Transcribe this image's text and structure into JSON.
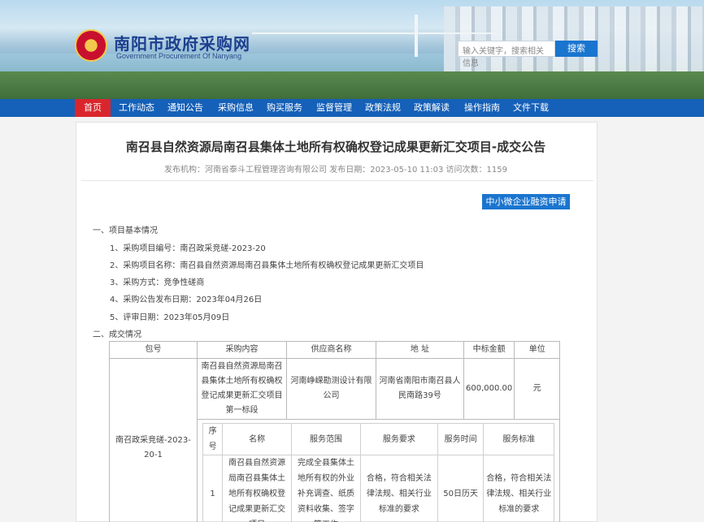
{
  "site": {
    "title": "南阳市政府采购网",
    "subtitle": "Government Procurement Of Nanyang",
    "logo_icon": "national-emblem-icon",
    "search_placeholder": "输入关键字，搜索相关信息",
    "search_button": "搜索"
  },
  "nav": {
    "items": [
      {
        "label": "首页",
        "active": true
      },
      {
        "label": "工作动态"
      },
      {
        "label": "通知公告"
      },
      {
        "label": "采购信息"
      },
      {
        "label": "购买服务"
      },
      {
        "label": "监督管理"
      },
      {
        "label": "政策法规"
      },
      {
        "label": "政策解读"
      },
      {
        "label": "操作指南"
      },
      {
        "label": "文件下载"
      }
    ]
  },
  "article": {
    "title": "南召县自然资源局南召县集体土地所有权确权登记成果更新汇交项目-成交公告",
    "meta": "发布机构：河南省泰斗工程管理咨询有限公司   发布日期：2023-05-10 11:03   访问次数：1159",
    "loan_button": "中小微企业融资申请",
    "section1": "一、项目基本情况",
    "items": [
      "1、采购项目编号：南召政采竞磋-2023-20",
      "2、采购项目名称：南召县自然资源局南召县集体土地所有权确权登记成果更新汇交项目",
      "3、采购方式：竞争性磋商",
      "4、采购公告发布日期：2023年04月26日",
      "5、评审日期：2023年05月09日"
    ],
    "section2": "二、成交情况"
  },
  "table": {
    "headers": [
      "包号",
      "采购内容",
      "供应商名称",
      "地 址",
      "中标金额",
      "单位"
    ],
    "row": {
      "package": "南召政采竞磋-2023-20-1",
      "content": "南召县自然资源局南召县集体土地所有权确权登记成果更新汇交项目第一标段",
      "supplier": "河南峥嵘勘测设计有限公司",
      "address": "河南省南阳市南召县人民南路39号",
      "amount": "600,000.00",
      "unit": "元"
    },
    "inner_headers": [
      "序号",
      "名称",
      "服务范围",
      "服务要求",
      "服务时间",
      "服务标准"
    ],
    "inner_row": {
      "no": "1",
      "name": "南召县自然资源局南召县集体土地所有权确权登记成果更新汇交项目",
      "scope": "完成全县集体土地所有权的外业补充调查、纸质资料收集、签字等工作",
      "req": "合格，符合相关法律法规、相关行业标准的要求",
      "time": "50日历天",
      "std": "合格，符合相关法律法规、相关行业标准的要求"
    }
  },
  "colors": {
    "nav_bg": "#1560b8",
    "nav_active": "#d9262c",
    "button": "#1a75cf",
    "title_blue": "#1c3f8f"
  }
}
